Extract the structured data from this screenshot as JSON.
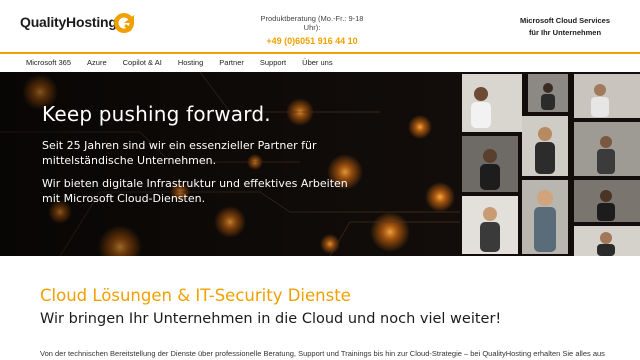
{
  "header": {
    "logo_text": "QualityHosting",
    "contact_label": "Produktberatung (Mo.-Fr.: 9-18 Uhr):",
    "contact_phone": "+49 (0)6051 916 44 10",
    "cloud_services_line1": "Microsoft Cloud Services",
    "cloud_services_line2": "für Ihr Unternehmen"
  },
  "nav": {
    "items": [
      {
        "label": "Microsoft 365"
      },
      {
        "label": "Azure"
      },
      {
        "label": "Copilot & AI"
      },
      {
        "label": "Hosting"
      },
      {
        "label": "Partner"
      },
      {
        "label": "Support"
      },
      {
        "label": "Über uns"
      }
    ]
  },
  "hero": {
    "title": "Keep pushing forward.",
    "paragraph1": "Seit 25 Jahren sind wir ein essenzieller Partner für mittelständische Unternehmen.",
    "paragraph2": "Wir bieten digitale Infrastruktur und effektives Arbeiten mit Microsoft Cloud-Diensten."
  },
  "section": {
    "title": "Cloud Lösungen & IT-Security Dienste",
    "subtitle": "Wir bringen Ihr Unternehmen in die Cloud und noch viel weiter!",
    "body": "Von der technischen Bereitstellung der Dienste über professionelle Beratung, Support und Trainings bis hin zur Cloud-Strategie – bei QualityHosting erhalten Sie alles aus"
  },
  "colors": {
    "accent": "#f0a000",
    "text_dark": "#1b1b1b",
    "hero_bg": "#0b0908"
  }
}
